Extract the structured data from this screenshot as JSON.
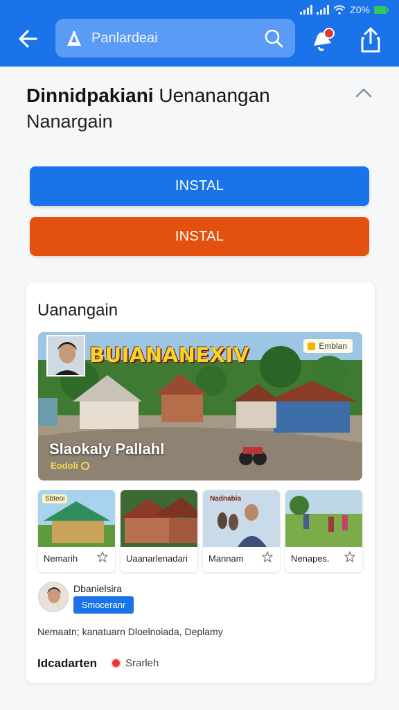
{
  "status_bar": {
    "battery_text": "Z0%"
  },
  "app_bar": {
    "back_icon": "arrow-left-icon",
    "search_text": "Panlardeai",
    "logo_icon": "app-logo-icon",
    "search_icon": "search-icon",
    "notification_icon": "notification-bell-icon",
    "share_icon": "share-icon",
    "accent_color": "#1a73e8"
  },
  "header": {
    "title_line1_bold": "Dinnidpakiani",
    "title_line1_rest": " Uenanangan",
    "title_line2": "Nanargain",
    "collapse_icon": "chevron-up-icon"
  },
  "buttons": {
    "install_primary": "INSTAL",
    "install_secondary": "INSTAL",
    "primary_color": "#1a73e8",
    "secondary_color": "#e4500e"
  },
  "card": {
    "title": "Uanangain",
    "hero": {
      "banner_text": "BUIANANEXIV",
      "badge_text": "Emblan",
      "caption": "Slaokaly Pallahl",
      "sub_caption": "Eodoli"
    },
    "thumbnails": [
      {
        "label": "Nemarih",
        "tag": "Sbteoi"
      },
      {
        "label": "Uaanarlenadari",
        "tag": ""
      },
      {
        "label": "Mannam",
        "tag": "Nadnabia"
      },
      {
        "label": "Nenapes.",
        "tag": ""
      }
    ],
    "author": {
      "name": "Dbanielsira",
      "chip": "Smoceranr"
    },
    "description": "Nemaatn; kanatuarn Dloelnoiada, Deplamy",
    "footer": {
      "left": "Idcadarten",
      "right": "Srarleh",
      "right_icon": "record-dot-icon"
    }
  }
}
